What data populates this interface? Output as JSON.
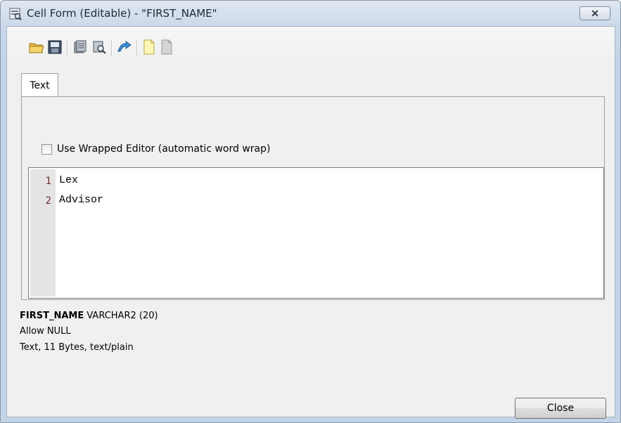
{
  "window": {
    "title": "Cell Form (Editable) - \"FIRST_NAME\"",
    "close_glyph": "✕"
  },
  "toolbar": {
    "buttons": [
      {
        "icon": "open-folder-icon"
      },
      {
        "icon": "save-to-file-icon"
      },
      {
        "icon": "load-lob-icon"
      },
      {
        "icon": "view-lob-icon"
      },
      {
        "icon": "open-external-icon"
      },
      {
        "icon": "new-document-icon"
      },
      {
        "icon": "edit-document-icon"
      }
    ]
  },
  "tabs": [
    {
      "label": "Text",
      "active": true
    }
  ],
  "wrap_option": {
    "label": "Use Wrapped Editor (automatic word wrap)",
    "checked": false
  },
  "editor": {
    "lines": [
      {
        "number": "1",
        "text": "Lex"
      },
      {
        "number": "2",
        "text": "Advisor"
      }
    ]
  },
  "column_info": {
    "name": "FIRST_NAME",
    "type": "VARCHAR2 (20)",
    "nullability": "Allow NULL",
    "content": "Text, 11 Bytes, text/plain"
  },
  "buttons": {
    "close_label": "Close"
  },
  "colors": {
    "titlebar": "#c9d8ea",
    "line_number": "#6f2b2b",
    "gutter": "#e4e4e4"
  }
}
